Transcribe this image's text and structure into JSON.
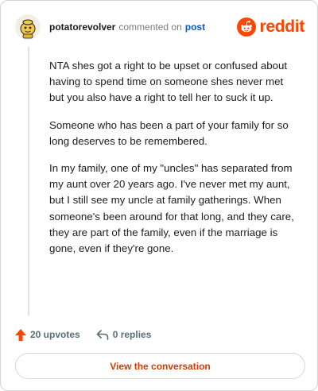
{
  "comment": {
    "username": "potatorevolver",
    "action_text": "commented on",
    "post_link": "post",
    "paragraphs": [
      "NTA shes got a right to be upset or confused about having to spend time on someone shes never met but you also have a right to tell her to suck it up.",
      "Someone who has been a part of your family for so long deserves to be remembered.",
      "In my family, one of my \"uncles\" has separated from my aunt over 20 years ago. I've never met my aunt, but I still see my uncle at family gatherings. When someone's been around for that long, and they care, they are part of the family, even if the marriage is gone, even if they're gone."
    ]
  },
  "brand": {
    "name": "reddit",
    "color": "#ff4500"
  },
  "actions": {
    "upvotes_label": "20 upvotes",
    "replies_label": "0 replies",
    "upvote_icon": "upvote-arrow-icon",
    "reply_icon": "reply-arrow-icon"
  },
  "cta": {
    "label": "View the conversation"
  },
  "colors": {
    "accent": "#ff4500",
    "link": "#0b57d0",
    "cta_text": "#d93a00",
    "muted": "#576f76"
  }
}
